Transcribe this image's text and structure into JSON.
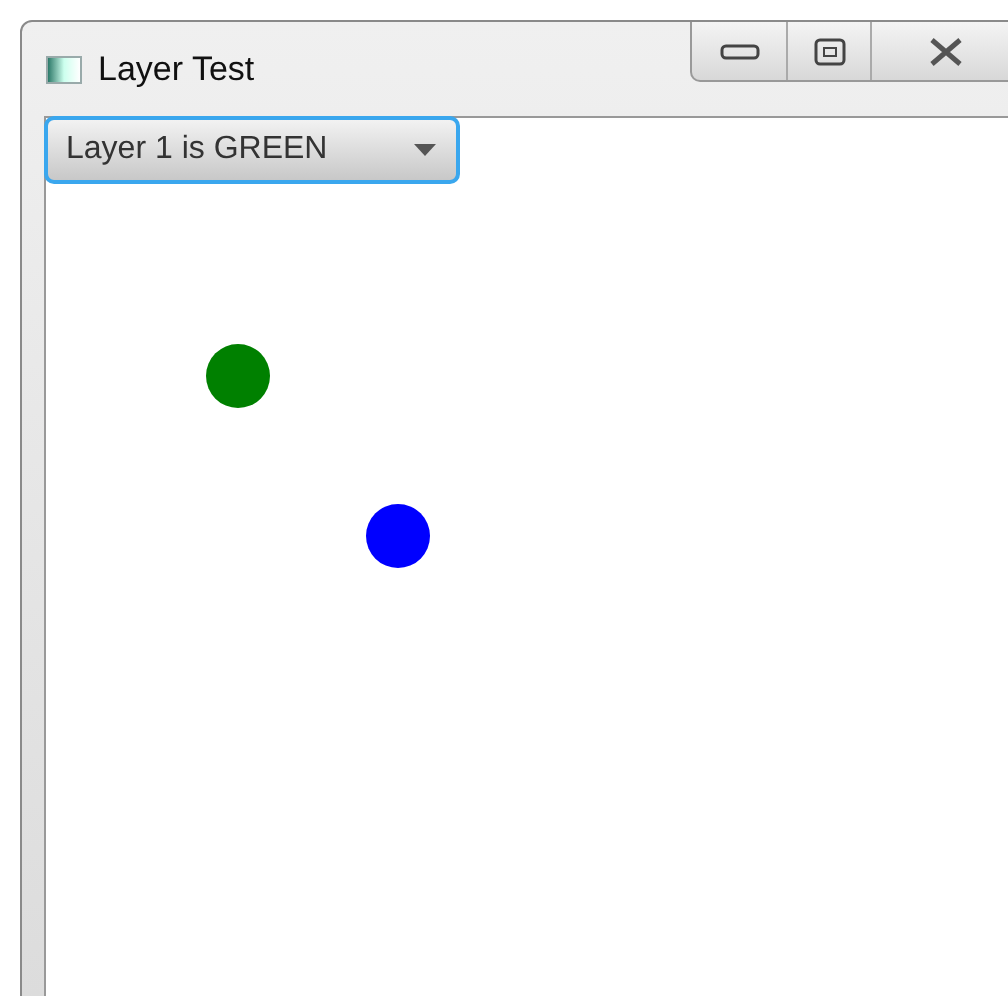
{
  "window": {
    "title": "Layer Test"
  },
  "layer_select": {
    "value": "Layer 1 is GREEN"
  },
  "canvas": {
    "dots": [
      {
        "color": "#008000"
      },
      {
        "color": "#0000ff"
      }
    ]
  }
}
